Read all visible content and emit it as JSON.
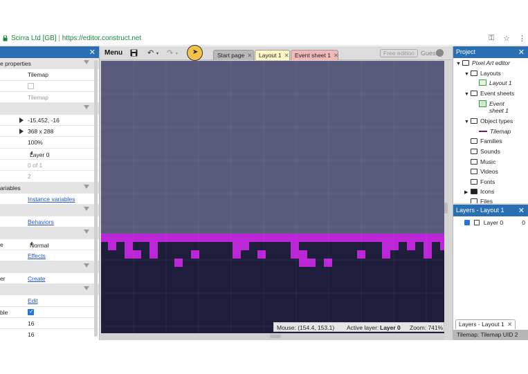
{
  "browser": {
    "site_name": "Scirra Ltd [GB]",
    "url": "https://editor.construct.net",
    "icons": [
      "lock-icon",
      "key-icon",
      "star-icon",
      "kebab-menu-icon"
    ]
  },
  "properties": {
    "rows": [
      {
        "label": "e properties",
        "type": "section"
      },
      {
        "label": "",
        "value": "Tilemap",
        "type": "text"
      },
      {
        "label": "",
        "value": "",
        "type": "checkbox",
        "checked": false
      },
      {
        "label": "",
        "value": "Tilemap",
        "type": "muted"
      },
      {
        "label": "",
        "type": "section"
      },
      {
        "label": "",
        "value": "-15.452, -16",
        "type": "expand"
      },
      {
        "label": "",
        "value": "368 x 288",
        "type": "expand"
      },
      {
        "label": "",
        "value": "100%",
        "type": "text"
      },
      {
        "label": "",
        "value": "Layer 0",
        "type": "select"
      },
      {
        "label": "",
        "value": "0 of 1",
        "type": "muted"
      },
      {
        "label": "",
        "value": "2",
        "type": "muted"
      },
      {
        "label": "ariables",
        "type": "section"
      },
      {
        "label": "",
        "value": "Instance variables",
        "type": "link"
      },
      {
        "label": "",
        "type": "section"
      },
      {
        "label": "",
        "value": "Behaviors",
        "type": "link"
      },
      {
        "label": "",
        "type": "section"
      },
      {
        "label": "e",
        "value": "Normal",
        "type": "select"
      },
      {
        "label": "",
        "value": "Effects",
        "type": "link"
      },
      {
        "label": "",
        "type": "section"
      },
      {
        "label": "er",
        "value": "Create",
        "type": "link"
      },
      {
        "label": "",
        "type": "section"
      },
      {
        "label": "",
        "value": "Edit",
        "type": "link"
      },
      {
        "label": "ble",
        "value": "",
        "type": "checkbox",
        "checked": true
      },
      {
        "label": "",
        "value": "16",
        "type": "text"
      },
      {
        "label": "",
        "value": "16",
        "type": "text"
      }
    ]
  },
  "toolbar": {
    "menu_label": "Menu",
    "icons": [
      "save-icon",
      "undo-icon",
      "redo-icon",
      "cursor-icon"
    ],
    "tabs": [
      {
        "label": "Start page",
        "bg": "#b9b9b9"
      },
      {
        "label": "Layout 1",
        "bg": "#fff7c4"
      },
      {
        "label": "Event sheet 1",
        "bg": "#f2b8b8"
      }
    ],
    "free_edition": "Free edition",
    "guest": "Guest"
  },
  "canvas": {
    "sky_color": "#5a5b7c",
    "ground_color": "#1e1d3b",
    "tile_color": "#bb27d6"
  },
  "status": {
    "mouse": "Mouse: (154.4, 153.1)",
    "active_layer_label": "Active layer:",
    "active_layer": "Layer 0",
    "zoom": "Zoom: 741%"
  },
  "project": {
    "title": "Project",
    "items": [
      {
        "label": "Pixel Art editor",
        "icon": "folder",
        "arrow": "▼",
        "italic": true
      },
      {
        "label": "Layouts",
        "icon": "folder",
        "arrow": "▼"
      },
      {
        "label": "Layout 1",
        "icon": "layout",
        "italic": true
      },
      {
        "label": "Event sheets",
        "icon": "folder",
        "arrow": "▼"
      },
      {
        "label": "Event sheet 1",
        "icon": "event",
        "italic": true
      },
      {
        "label": "Object types",
        "icon": "folder",
        "arrow": "▼"
      },
      {
        "label": "Tilemap",
        "icon": "tilemap",
        "italic": true
      },
      {
        "label": "Families",
        "icon": "folder"
      },
      {
        "label": "Sounds",
        "icon": "folder"
      },
      {
        "label": "Music",
        "icon": "folder"
      },
      {
        "label": "Videos",
        "icon": "folder"
      },
      {
        "label": "Fonts",
        "icon": "folder"
      },
      {
        "label": "Icons",
        "icon": "folder-filled",
        "arrow": "▶"
      },
      {
        "label": "Files",
        "icon": "folder"
      }
    ]
  },
  "layers": {
    "title": "Layers - Layout 1",
    "rows": [
      {
        "label": "Layer 0",
        "num": "0"
      }
    ],
    "bottom_tab": "Layers - Layout 1",
    "bottom_bar": "Tilemap: Tilemap UID 2"
  }
}
